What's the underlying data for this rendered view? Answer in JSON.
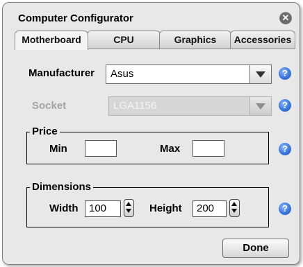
{
  "window": {
    "title": "Computer Configurator",
    "close_icon": "close-icon",
    "close_glyph": "✕"
  },
  "tabs": [
    {
      "label": "Motherboard",
      "active": true
    },
    {
      "label": "CPU",
      "active": false
    },
    {
      "label": "Graphics",
      "active": false
    },
    {
      "label": "Accessories",
      "active": false
    }
  ],
  "manufacturer": {
    "label": "Manufacturer",
    "value": "Asus"
  },
  "socket": {
    "label": "Socket",
    "value": "LGA1156",
    "enabled": false
  },
  "price": {
    "title": "Price",
    "min_label": "Min",
    "min_value": "",
    "max_label": "Max",
    "max_value": ""
  },
  "dimensions": {
    "title": "Dimensions",
    "width_label": "Width",
    "width_value": "100",
    "height_label": "Height",
    "height_value": "200"
  },
  "help_glyph": "?",
  "done_label": "Done",
  "colors": {
    "help_blue": "#3a77e0",
    "disabled_text": "#a3a3a3"
  }
}
